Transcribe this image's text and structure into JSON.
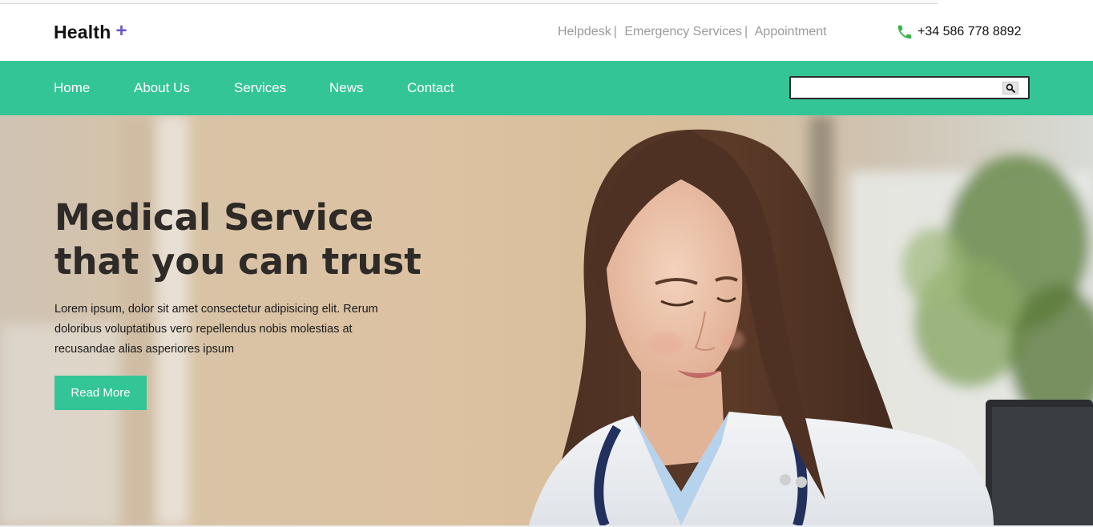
{
  "header": {
    "brand_name": "Health",
    "brand_symbol": "+",
    "top_links": [
      "Helpdesk",
      "Emergency Services",
      "Appointment"
    ],
    "separator": "|",
    "phone_number": "+34 586 778 8892",
    "phone_icon": "phone-icon"
  },
  "nav": {
    "items": [
      "Home",
      "About Us",
      "Services",
      "News",
      "Contact"
    ],
    "search_value": "",
    "search_icon": "search-icon"
  },
  "hero": {
    "title_lines": [
      "Medical Service",
      "that you can trust"
    ],
    "text_lines": [
      "Lorem ipsum, dolor sit amet consectetur adipisicing elit. Rerum",
      "doloribus voluptatibus vero repellendus nobis molestias at",
      "recusandae alias asperiores ipsum"
    ],
    "button_label": "Read More",
    "image": "doctor-photo"
  },
  "colors": {
    "accent": "#34c596",
    "brand_plus": "#6a55c9",
    "phone_icon": "#3bb54a",
    "title": "#2e2a27",
    "top_links": "#9a9a9a"
  }
}
